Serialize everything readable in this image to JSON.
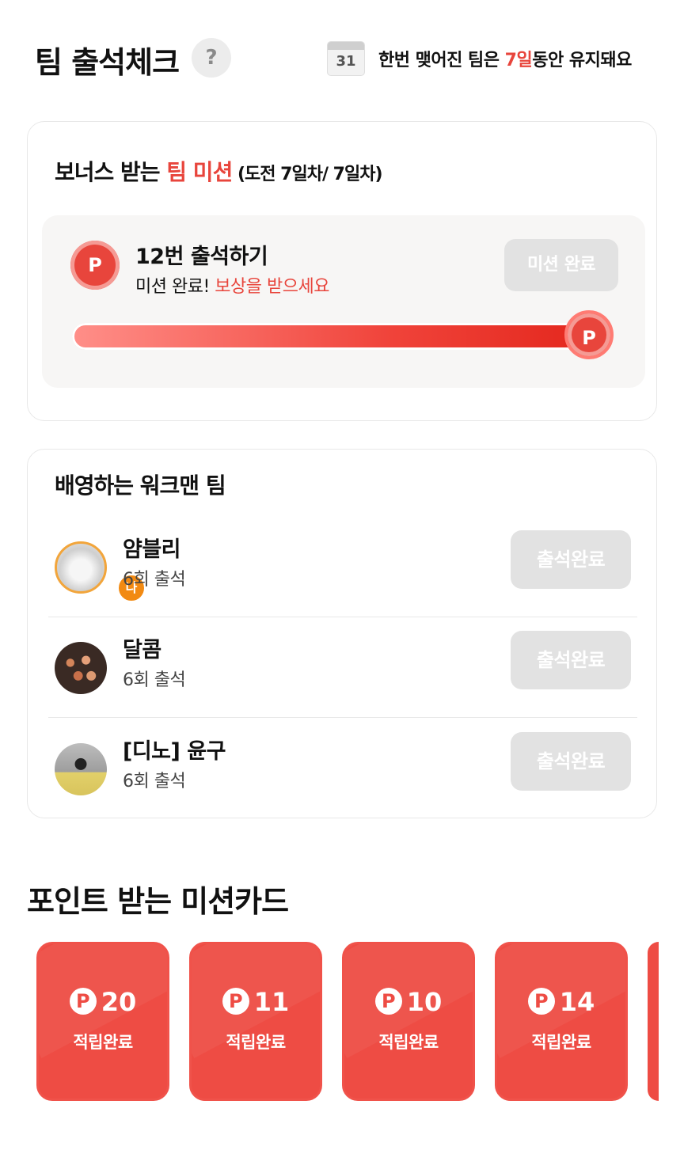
{
  "header": {
    "title": "팀 출석체크",
    "help_label": "?",
    "calendar_date": "31",
    "keep_note_prefix": "한번 맺어진 팀은 ",
    "keep_note_highlight": "7일",
    "keep_note_suffix": "동안 유지돼요"
  },
  "mission": {
    "title_prefix": "보너스 받는 ",
    "title_highlight": "팀 미션",
    "title_sub": " (도전 7일차/ 7일차)",
    "coin_label": "P",
    "name": "12번 출석하기",
    "status_prefix": "미션 완료! ",
    "status_highlight": "보상을 받으세요",
    "done_button": "미션 완료",
    "progress": 1.0
  },
  "team": {
    "title": "배영하는 워크맨 팀",
    "members": [
      {
        "name": "얌블리",
        "count": "6회 출석",
        "badge": "나",
        "button": "출석완료"
      },
      {
        "name": "달콤",
        "count": "6회 출석",
        "button": "출석완료"
      },
      {
        "name": "[디노] 윤구",
        "count": "6회 출석",
        "button": "출석완료"
      }
    ]
  },
  "mission_cards": {
    "title": "포인트 받는 미션카드",
    "coin_label": "P",
    "cards": [
      {
        "amount": "20",
        "label": "적립완료"
      },
      {
        "amount": "11",
        "label": "적립완료"
      },
      {
        "amount": "10",
        "label": "적립완료"
      },
      {
        "amount": "14",
        "label": "적립완료"
      }
    ]
  },
  "colors": {
    "accent": "#e8453c",
    "card_red": "#ee4c44",
    "disabled_button": "#e2e2e2",
    "badge_orange": "#f28a12"
  }
}
